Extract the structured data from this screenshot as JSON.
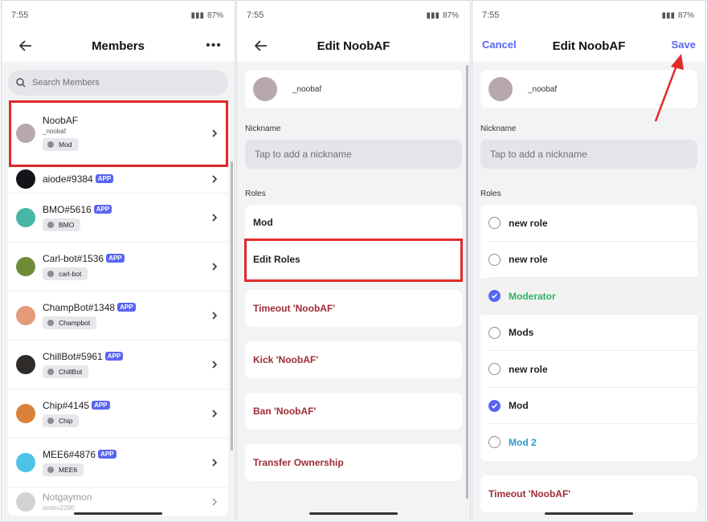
{
  "status": {
    "time": "7:55",
    "battery": "87%"
  },
  "panel1": {
    "title": "Members",
    "search_placeholder": "Search Members",
    "members": [
      {
        "name": "NoobAF",
        "sub": "_noobaf",
        "role": "Mod",
        "app": false,
        "avatar": "#b7a8b0"
      },
      {
        "name": "aiode#9384",
        "app": true,
        "avatar": "#15131a"
      },
      {
        "name": "BMO#5616",
        "role": "BMO",
        "app": true,
        "avatar": "#47b6a7"
      },
      {
        "name": "Carl-bot#1536",
        "role": "carl-bot",
        "app": true,
        "avatar": "#6f8b3a"
      },
      {
        "name": "ChampBot#1348",
        "role": "Champbot",
        "app": true,
        "avatar": "#e49b7a"
      },
      {
        "name": "ChillBot#5961",
        "role": "ChillBot",
        "app": true,
        "avatar": "#2e2b29"
      },
      {
        "name": "Chip#4145",
        "role": "Chip",
        "app": true,
        "avatar": "#d9813a"
      },
      {
        "name": "MEE6#4876",
        "role": "MEE6",
        "app": true,
        "avatar": "#4cc3e8"
      },
      {
        "name": "Notgaymon",
        "sub": "ansbu2290",
        "app": false,
        "avatar": "#9a9ca1"
      }
    ],
    "app_label": "APP"
  },
  "panel2": {
    "title": "Edit NoobAF",
    "username": "_noobaf",
    "nickname_label": "Nickname",
    "nickname_placeholder": "Tap to add a nickname",
    "roles_label": "Roles",
    "role_current": "Mod",
    "edit_roles": "Edit Roles",
    "actions": [
      "Timeout 'NoobAF'",
      "Kick 'NoobAF'",
      "Ban 'NoobAF'",
      "Transfer Ownership"
    ]
  },
  "panel3": {
    "title": "Edit NoobAF",
    "cancel": "Cancel",
    "save": "Save",
    "username": "_noobaf",
    "nickname_label": "Nickname",
    "nickname_placeholder": "Tap to add a nickname",
    "roles_label": "Roles",
    "roles": [
      {
        "name": "new role",
        "checked": false,
        "color": "#1f1f24"
      },
      {
        "name": "new role",
        "checked": false,
        "color": "#1f1f24"
      },
      {
        "name": "Moderator",
        "checked": true,
        "color": "#2fb36a"
      },
      {
        "name": "Mods",
        "checked": false,
        "color": "#1f1f24"
      },
      {
        "name": "new role",
        "checked": false,
        "color": "#1f1f24"
      },
      {
        "name": "Mod",
        "checked": true,
        "color": "#1f1f24"
      },
      {
        "name": "Mod 2",
        "checked": false,
        "color": "#2a9bd0"
      }
    ],
    "timeout": "Timeout 'NoobAF'"
  },
  "colors": {
    "blurple": "#5865f2",
    "danger": "#9e2b36",
    "highlight": "#e12a2a"
  }
}
